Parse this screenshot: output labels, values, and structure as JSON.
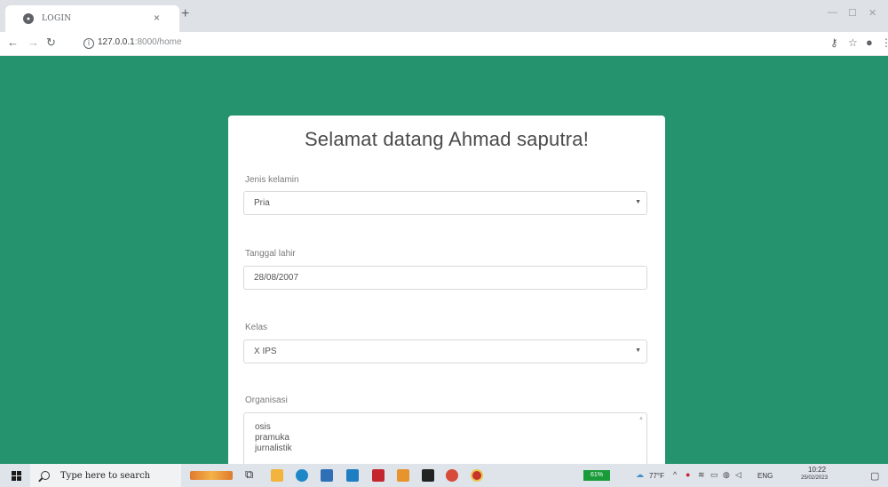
{
  "browser": {
    "tab_title": "LOGIN",
    "tab_close": "×",
    "new_tab": "+",
    "url_host": "127.0.0.1",
    "url_path": ":8000/home",
    "window_controls": [
      "—",
      "☐",
      "✕"
    ]
  },
  "page": {
    "background_color": "#26936f",
    "heading": "Selamat datang Ahmad saputra!",
    "fields": {
      "gender": {
        "label": "Jenis kelamin",
        "value": "Pria"
      },
      "birthdate": {
        "label": "Tanggal lahir",
        "value": "28/08/2007"
      },
      "class": {
        "label": "Kelas",
        "value": "X IPS"
      },
      "organization": {
        "label": "Organisasi",
        "options": [
          "osis",
          "pramuka",
          "jurnalistik"
        ]
      }
    }
  },
  "taskbar": {
    "search_placeholder": "Type here to search",
    "battery": "61%",
    "weather": "77°F",
    "language": "ENG",
    "time": "10:22",
    "date": "25/02/2023"
  }
}
